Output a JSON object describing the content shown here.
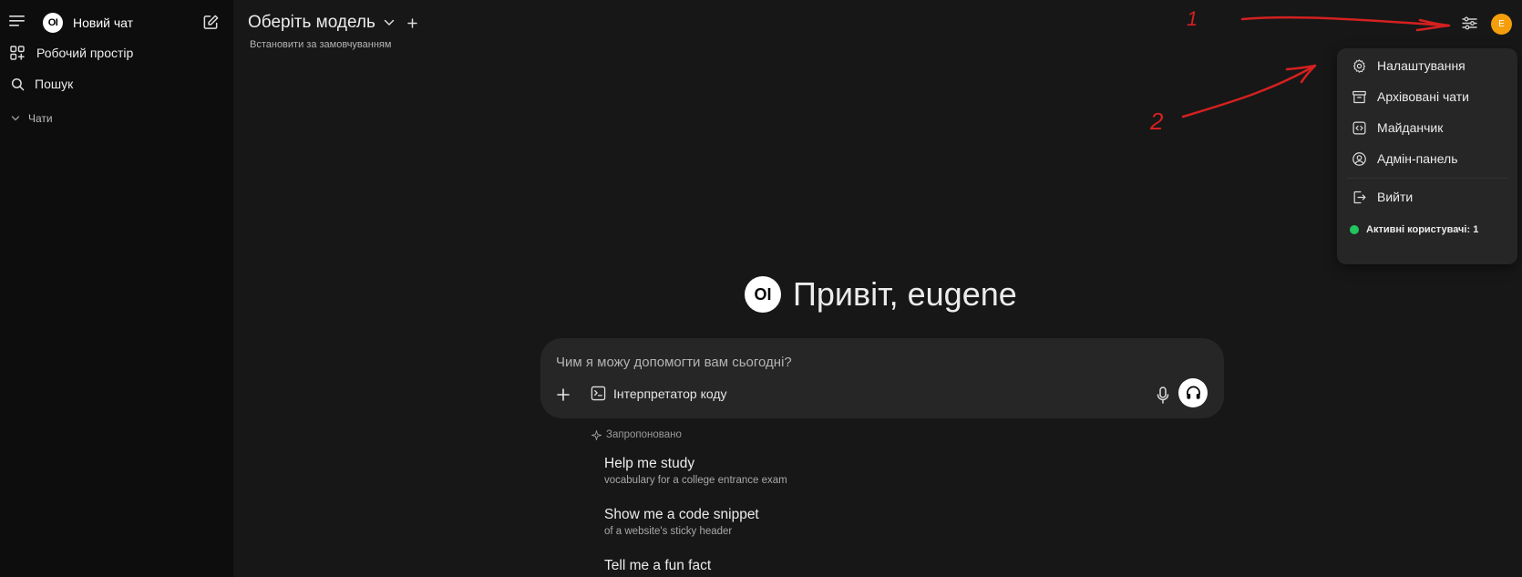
{
  "sidebar": {
    "new_chat": "Новий чат",
    "workspace": "Робочий простір",
    "search": "Пошук",
    "chats_section": "Чати"
  },
  "header": {
    "model_select": "Оберіть модель",
    "set_default": "Встановити за замовчуванням",
    "avatar_letter": "E"
  },
  "user_menu": {
    "items": [
      {
        "label": "Налаштування",
        "icon": "gear-icon"
      },
      {
        "label": "Архівовані чати",
        "icon": "archive-icon"
      },
      {
        "label": "Майданчик",
        "icon": "code-icon"
      },
      {
        "label": "Адмін-панель",
        "icon": "user-circle-icon"
      },
      {
        "label": "Вийти",
        "icon": "logout-icon"
      }
    ],
    "active_users": "Активні користувачі: 1",
    "status_color": "#22c55e"
  },
  "main": {
    "greeting": "Привіт, eugene",
    "logo_text": "OI",
    "input_placeholder": "Чим я можу допомогти вам сьогодні?",
    "code_interpreter": "Інтерпретатор коду",
    "suggested_label": "Запропоновано",
    "suggestions": [
      {
        "title": "Help me study",
        "subtitle": "vocabulary for a college entrance exam"
      },
      {
        "title": "Show me a code snippet",
        "subtitle": "of a website's sticky header"
      },
      {
        "title": "Tell me a fun fact",
        "subtitle": ""
      }
    ]
  },
  "annotations": {
    "mark_1": "1",
    "mark_2": "2",
    "color": "#d42020"
  },
  "colors": {
    "avatar": "#f59e0b",
    "background": "#171717",
    "sidebar": "#0d0d0d"
  }
}
